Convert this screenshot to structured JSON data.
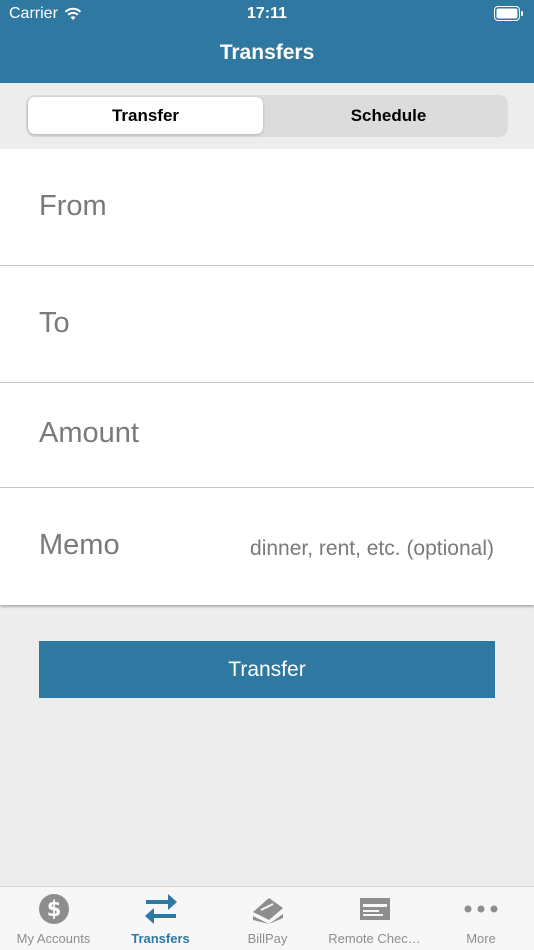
{
  "status_bar": {
    "carrier": "Carrier",
    "time": "17:11"
  },
  "nav": {
    "title": "Transfers"
  },
  "segment": {
    "options": [
      "Transfer",
      "Schedule"
    ],
    "selected": "Transfer"
  },
  "form": {
    "from_label": "From",
    "to_label": "To",
    "amount_label": "Amount",
    "memo_label": "Memo",
    "memo_placeholder": "dinner, rent, etc. (optional)"
  },
  "actions": {
    "transfer_label": "Transfer"
  },
  "tabs": [
    {
      "label": "My Accounts",
      "icon": "dollar-coin-icon"
    },
    {
      "label": "Transfers",
      "icon": "swap-arrows-icon",
      "active": true
    },
    {
      "label": "BillPay",
      "icon": "bill-icon"
    },
    {
      "label": "Remote Chec…",
      "icon": "check-icon"
    },
    {
      "label": "More",
      "icon": "more-dots-icon"
    }
  ],
  "colors": {
    "accent": "#2f78a1",
    "inactive": "#8e8e8e",
    "background": "#ededed"
  }
}
